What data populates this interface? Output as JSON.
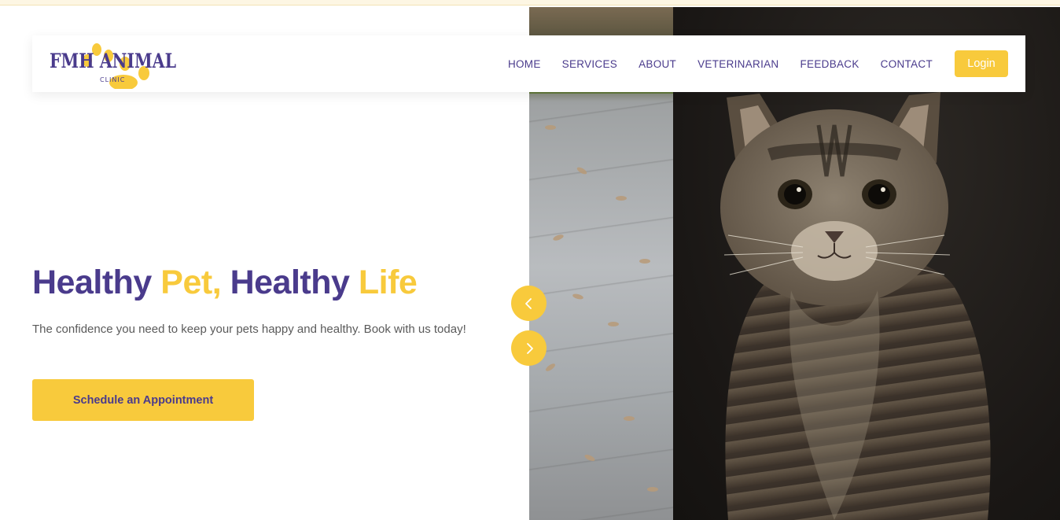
{
  "brand": {
    "logo_title": "FMH ANIMAL",
    "logo_subtitle": "CLINIC"
  },
  "nav": {
    "items": [
      {
        "label": "HOME"
      },
      {
        "label": "SERVICES"
      },
      {
        "label": "ABOUT"
      },
      {
        "label": "VETERINARIAN"
      },
      {
        "label": "FEEDBACK"
      },
      {
        "label": "CONTACT"
      }
    ],
    "login_label": "Login"
  },
  "hero": {
    "title_parts": {
      "p1": "Healthy ",
      "p2": "Pet, ",
      "p3": "Healthy ",
      "p4": "Life"
    },
    "subtitle": "The confidence you need to keep your pets happy and healthy. Book with us today!",
    "cta_label": "Schedule an Appointment"
  },
  "carousel": {
    "prev_icon": "chevron-left-icon",
    "next_icon": "chevron-right-icon"
  },
  "colors": {
    "brand_purple": "#4a3b8c",
    "brand_yellow": "#f8ca3c",
    "body_text": "#5a5a5a"
  }
}
